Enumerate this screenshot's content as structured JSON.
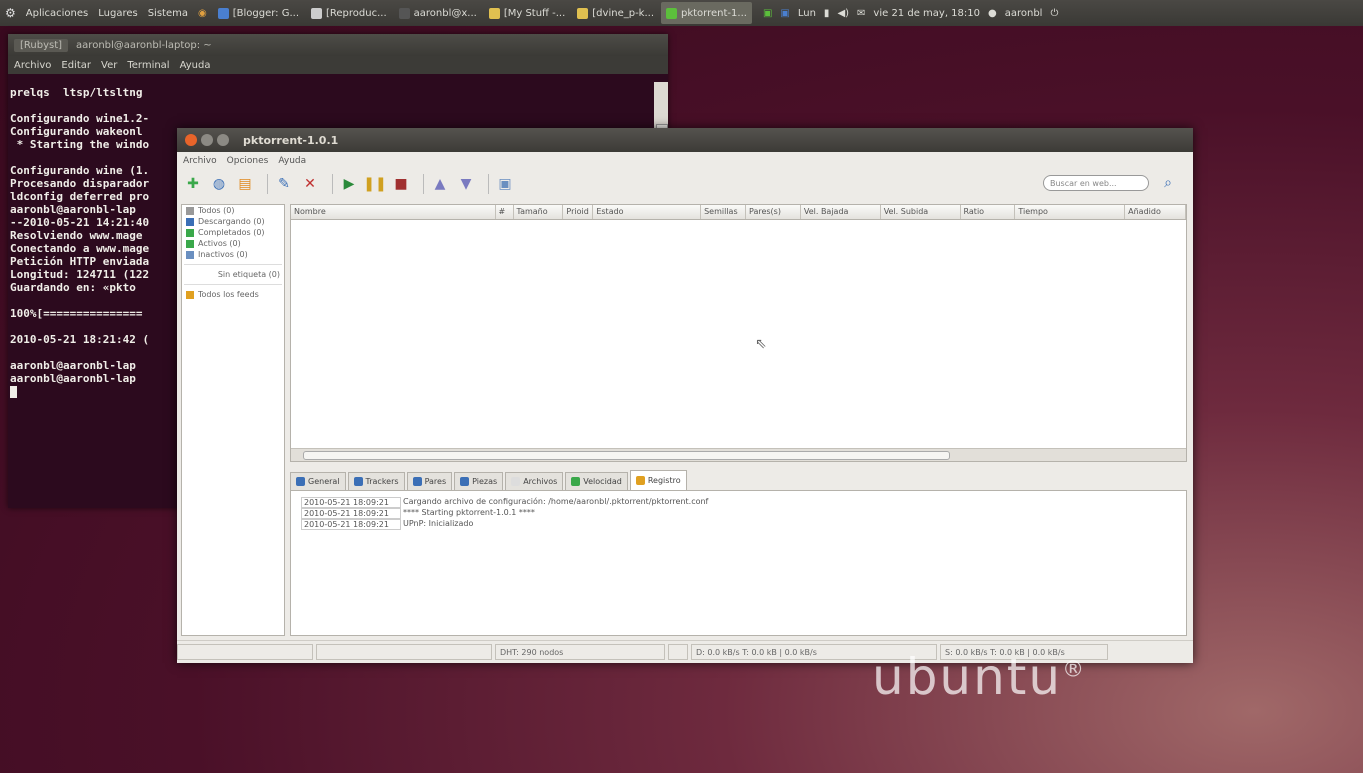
{
  "top_panel": {
    "menus": [
      "Aplicaciones",
      "Lugares",
      "Sistema"
    ],
    "tasks": [
      {
        "label": "[Blogger: G...",
        "color": "#4a7fcf"
      },
      {
        "label": "[Reproduc...",
        "color": "#cccccc"
      },
      {
        "label": "aaronbl@x...",
        "color": "#555555"
      },
      {
        "label": "[My Stuff -...",
        "color": "#e0c050"
      },
      {
        "label": "[dvine_p-k...",
        "color": "#e0c050"
      },
      {
        "label": "pktorrent-1...",
        "color": "#5cbf3c",
        "active": true
      }
    ],
    "clock": "vie 21 de may, 18:10",
    "user": "aaronbl",
    "lang": "Lun"
  },
  "terminal": {
    "title": "aaronbl@aaronbl-laptop: ~",
    "tab_label": "[Rubyst]",
    "menus": [
      "Archivo",
      "Editar",
      "Ver",
      "Terminal",
      "Ayuda"
    ],
    "lines": [
      "prelqs  ltsp/ltsltng",
      "",
      "Configurando wine1.2-",
      "Configurando wakeonl",
      " * Starting the windo",
      "",
      "Configurando wine (1.",
      "Procesando disparador",
      "ldconfig deferred pro",
      "aaronbl@aaronbl-lap",
      "--2010-05-21 14:21:40",
      "Resolviendo www.mage",
      "Conectando a www.mage",
      "Petición HTTP enviada",
      "Longitud: 124711 (122",
      "Guardando en: «pkto",
      "",
      "100%[===============",
      "",
      "2010-05-21 18:21:42 (",
      "",
      "aaronbl@aaronbl-lap",
      "aaronbl@aaronbl-lap"
    ]
  },
  "app": {
    "title": "pktorrent-1.0.1",
    "menus": [
      "Archivo",
      "Opciones",
      "Ayuda"
    ],
    "search_placeholder": "Buscar en web...",
    "sidebar": {
      "items": [
        {
          "label": "Todos (0)",
          "color": "#999999"
        },
        {
          "label": "Descargando (0)",
          "color": "#3b6fb6"
        },
        {
          "label": "Completados (0)",
          "color": "#3aa84a"
        },
        {
          "label": "Activos (0)",
          "color": "#3aa84a"
        },
        {
          "label": "Inactivos (0)",
          "color": "#6a8fc0"
        }
      ],
      "status_label": "Sin etiqueta (0)",
      "feeds_label": "Todos los feeds"
    },
    "columns": [
      {
        "label": "Nombre",
        "w": 205
      },
      {
        "label": "#",
        "w": 18
      },
      {
        "label": "Tamaño",
        "w": 50
      },
      {
        "label": "Prioid",
        "w": 30
      },
      {
        "label": "Estado",
        "w": 108
      },
      {
        "label": "Semillas",
        "w": 45
      },
      {
        "label": "Pares(s)",
        "w": 55
      },
      {
        "label": "Vel. Bajada",
        "w": 80
      },
      {
        "label": "Vel. Subida",
        "w": 80
      },
      {
        "label": "Ratio",
        "w": 55
      },
      {
        "label": "Tiempo",
        "w": 110
      },
      {
        "label": "Añadido",
        "w": 61
      }
    ],
    "detail_tabs": [
      {
        "label": "General",
        "color": "#3b6fb6"
      },
      {
        "label": "Trackers",
        "color": "#3b6fb6"
      },
      {
        "label": "Pares",
        "color": "#3b6fb6"
      },
      {
        "label": "Piezas",
        "color": "#3b6fb6"
      },
      {
        "label": "Archivos",
        "color": "#dddddd"
      },
      {
        "label": "Velocidad",
        "color": "#3aa84a"
      },
      {
        "label": "Registro",
        "color": "#e0a020",
        "active": true
      }
    ],
    "log": [
      {
        "time": "2010-05-21 18:09:21",
        "msg": "Cargando archivo de configuración: /home/aaronbl/.pktorrent/pktorrent.conf"
      },
      {
        "time": "2010-05-21 18:09:21",
        "msg": "  ****  Starting pktorrent-1.0.1  ****"
      },
      {
        "time": "2010-05-21 18:09:21",
        "msg": "UPnP: Inicializado"
      }
    ],
    "status": {
      "dht": "DHT: 290 nodos",
      "down": "D: 0.0 kB/s T: 0.0 kB | 0.0 kB/s",
      "up": "S: 0.0 kB/s T: 0.0 kB | 0.0 kB/s"
    }
  },
  "desktop_logo": "ubuntu"
}
